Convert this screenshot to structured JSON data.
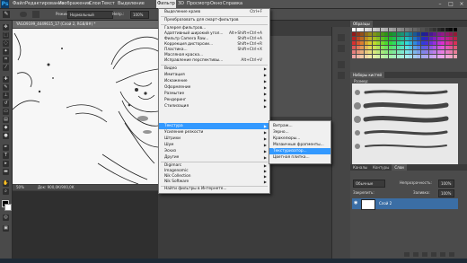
{
  "menubar": {
    "logo": "Ps",
    "items": [
      {
        "label": "Файл"
      },
      {
        "label": "Редактирование"
      },
      {
        "label": "Изображение"
      },
      {
        "label": "Слои"
      },
      {
        "label": "Текст"
      },
      {
        "label": "Выделение"
      },
      {
        "label": "Фильтр"
      },
      {
        "label": "3D"
      },
      {
        "label": "Просмотр"
      },
      {
        "label": "Окно"
      },
      {
        "label": "Справка"
      }
    ],
    "window_controls": [
      "–",
      "□",
      "×"
    ]
  },
  "options": {
    "mode_label": "Режим:",
    "mode_value": "Нормальный",
    "opacity_label": "Непр.:",
    "opacity_value": "100%"
  },
  "document": {
    "tab_title": "YAGO9199_4449615_17 (Слой 2, RGB/8#) *",
    "status_zoom": "50%",
    "status_doc": "Док: 900,0К/900,0К"
  },
  "filter_menu": {
    "items": [
      {
        "label": "Выделение краев",
        "shortcut": "Ctrl+F"
      },
      {
        "label": "Преобразовать для смарт-фильтров"
      },
      {
        "label": "Галерея фильтров..."
      },
      {
        "label": "Адаптивный широкий угол...",
        "shortcut": "Alt+Shift+Ctrl+A"
      },
      {
        "label": "Фильтр Camera Raw...",
        "shortcut": "Shift+Ctrl+A"
      },
      {
        "label": "Коррекция дисторсии...",
        "shortcut": "Shift+Ctrl+R"
      },
      {
        "label": "Пластика...",
        "shortcut": "Shift+Ctrl+X"
      },
      {
        "label": "Масляная краска..."
      },
      {
        "label": "Исправление перспективы...",
        "shortcut": "Alt+Ctrl+V"
      },
      {
        "label": "Видео",
        "sub": true
      },
      {
        "label": "Имитация",
        "sub": true
      },
      {
        "label": "Искажение",
        "sub": true
      },
      {
        "label": "Оформление",
        "sub": true
      },
      {
        "label": "Размытие",
        "sub": true
      },
      {
        "label": "Рендеринг",
        "sub": true
      },
      {
        "label": "Стилизация",
        "sub": true
      },
      {
        "label": "Текстура",
        "sub": true,
        "highlighted": true
      },
      {
        "label": "Усиление резкости",
        "sub": true
      },
      {
        "label": "Штрихи",
        "sub": true
      },
      {
        "label": "Шум",
        "sub": true
      },
      {
        "label": "Эскиз",
        "sub": true
      },
      {
        "label": "Другие",
        "sub": true
      },
      {
        "label": "Digimarc",
        "sub": true
      },
      {
        "label": "Imagenomic",
        "sub": true
      },
      {
        "label": "Nik Collection",
        "sub": true
      },
      {
        "label": "Nik Software",
        "sub": true
      },
      {
        "label": "Найти фильтры в Интернете..."
      }
    ]
  },
  "texture_submenu": {
    "items": [
      {
        "label": "Витраж..."
      },
      {
        "label": "Зерно..."
      },
      {
        "label": "Кракелюры..."
      },
      {
        "label": "Мозаичные фрагменты..."
      },
      {
        "label": "Текстуризатор...",
        "highlighted": true
      },
      {
        "label": "Цветная плитка..."
      }
    ]
  },
  "panels": {
    "swatches_tab": "Образцы",
    "brush_tab": "Наборы кистей",
    "brush_size_label": "Размер:",
    "layers_tabs": [
      "Каналы",
      "Контуры",
      "Слои"
    ],
    "blend_mode": "Обычные",
    "opacity_label": "Непрозрачность:",
    "opacity_value": "100%",
    "fill_label": "Заливка:",
    "fill_value": "100%",
    "lock_label": "Закрепить:",
    "layer_name": "Слой 2"
  },
  "colors": {
    "accent_highlight": "#3399ff",
    "menu_bg": "#f0f0f0",
    "app_bg": "#3c3c3c"
  }
}
